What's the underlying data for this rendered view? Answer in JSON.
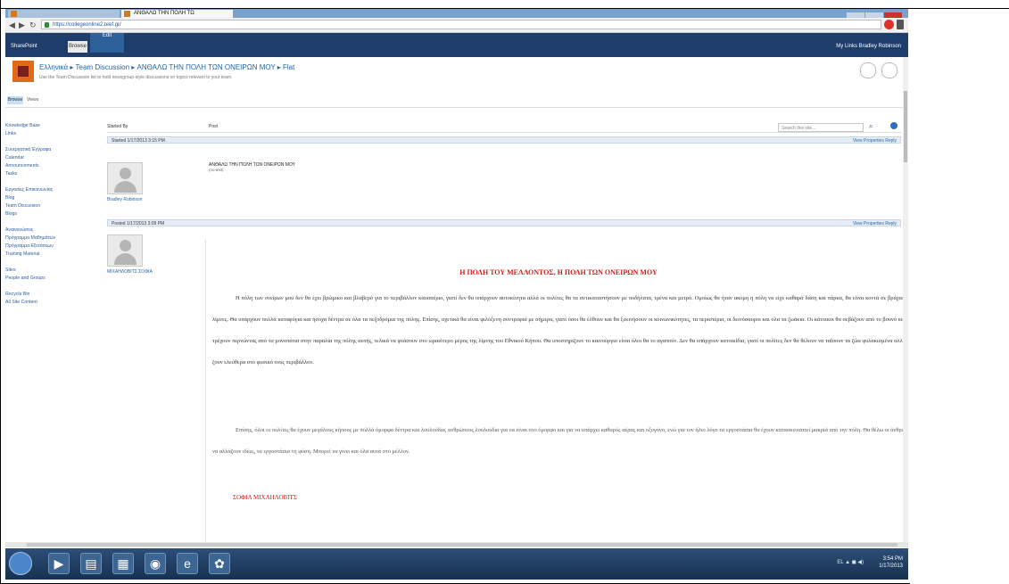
{
  "browser": {
    "tab1_label": "",
    "tab2_label": "ΑΝΘΑΛΩ ΤΗΝ ΠΟΛΗ ΤΩ",
    "url": "https://collegeonline2.teef.gr/"
  },
  "suite": {
    "left_label": "SharePoint",
    "browse_label": "Browse",
    "page_tab_label": "Edit",
    "right_label": "My Links   Bradley Robinson"
  },
  "site": {
    "breadcrumb": "Ελληνικά ▸ Team Discussion ▸ ΑΝΘΑΛΩ ΤΗΝ ΠΟΛΗ ΤΩΝ ΟΝΕΙΡΩΝ ΜΟΥ ▸ Flat",
    "subtitle": "Use the Team Discussion list to hold newsgroup-style discussions on topics relevant to your team."
  },
  "ribbon": {
    "browse": "Browse",
    "page": "Views"
  },
  "search": {
    "placeholder": "Search this site..."
  },
  "leftnav": {
    "items": [
      "Knowledge Base",
      "Links",
      "",
      "Συνεργατικά Έγγραφα",
      "Calendar",
      "Announcements",
      "Tasks",
      "",
      "Εργασίες Επικοινωνίας",
      "Blog",
      "Team Discussion",
      "Blogs",
      "",
      "Ανακοινώσεις",
      "Πρόγραμμα Μαθημάτων",
      "Πρόγραμμα Εξετάσεων",
      "Training Material",
      "",
      "Sites",
      "People and Groups",
      "",
      "Recycle Bin",
      "All Site Content"
    ]
  },
  "content": {
    "col_started": "Started By",
    "col_post": "Post",
    "post1": {
      "header": "Started 1/17/2013 3:15 PM",
      "actions": "View Properties  Reply",
      "author": "Bradley Robinson",
      "title": "ΑΝΘΑΛΩ ΤΗΝ ΠΟΛΗ ΤΩΝ ΟΝΕΙΡΩΝ ΜΟΥ",
      "sub": "(no text)"
    },
    "post2": {
      "header": "Posted 1/17/2013 3:09 PM",
      "actions": "View Properties  Reply",
      "author": "ΜΙΧΑΗΛΟΒΙΤΣ ΣΟΦΙΑ"
    }
  },
  "article": {
    "title": "Η ΠΟΛΗ ΤΟΥ ΜΕΛΛΟΝΤΟΣ, Η ΠΟΛΗ ΤΩΝ ΟΝΕΙΡΩΝ ΜΟΥ",
    "para1": "Η πόλη των ονείρων μου δεν θα έχει βρώμικο και βλαβερό για το περιβάλλον καυσαέριο, γιατί δεν θα υπάρχουν αυτοκίνητα αλλά οι πολίτες θα τα αντικαταστήσουν με ποδήλατα, τρένα και μετρό. Ομοίως θα ήταν ακόμη η πόλη να είχε καθαρά δάση και πάρκα, θα είναι κοντά σε βράχια και λίμνες. Θα υπάρχουν πολλά καταφύγια και ήσυχα δέντρα σε όλα τα πεζοδρόμια της πόλης. Επίσης, σχετικά θα είναι φιλόξενη συντροφιά με σήμερα, γιατί όσοι θα έλθουν και θα ξεκινήσουν οι κοινωνικότητες, τα περιστέρια, οι δεινόσαυροι και όλα τα ζωάκια. Οι κάτοικοι θα σεβάζουν από το βουνό και θα τρέχουν περνώντας από τα μονοπάτια στην παραλία της πόλης αυτής, τελικά να φτάσουν στο ωραιότερο μέρος της λίμνης του Εθνικού Κήπου. Θα υποστηρίζουν το καινούργιο είναι όλοι θα το αγαπούν. Δεν θα υπάρχουν κατοικίδια, γιατί οι πολίτες δεν θα θέλουν να ταΐσουν τα ζώα φυλακισμένα αλλά να ζουν ελεύθερα στο φυσικό τους περιβάλλον.",
    "para2": "Επίσης, όλοι οι πολίτες θα έχουν μεγάλους κήπους με πολλά όμορφα δέντρα και λουλούδια, ανθρώπους λουλούδια για να είναι στο όμορφο και για να υπάρχει καθαρός αέρας και οξυγόνο, ενώ για τον ήλιο λόγο τα εργοστάσια θα έχουν κατασκευαστεί μακριά από την πόλη. Θα θέλω οι άνθρωποι να αλλάζουν ιδέες, τα εργοστάσια τη φύση. Μπορεί να γίνει και όλα αυτά στο μέλλον.",
    "author": "ΣΟΦΙΑ ΜΙΧΑΗΛΟΒΙΤΣ"
  },
  "taskbar": {
    "tray": "EL  ▲  ◼  ◀)",
    "time": "3:54 PM",
    "date": "1/17/2013"
  }
}
